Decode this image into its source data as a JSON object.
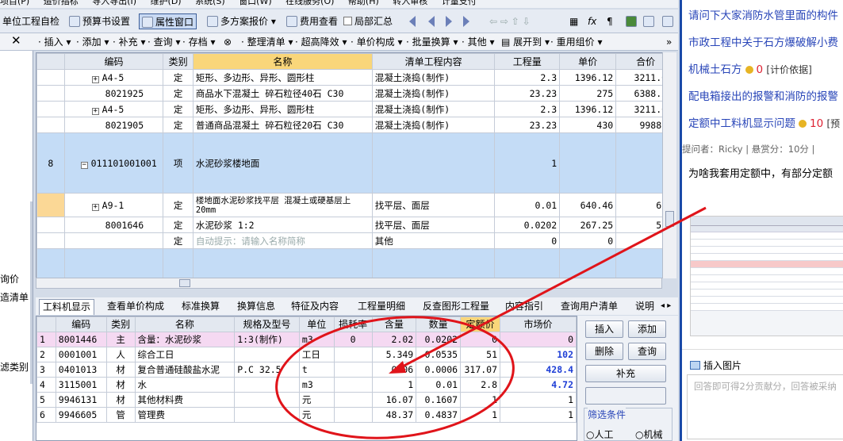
{
  "menubar": [
    "项目(P)",
    "造价指标",
    "导入导出(I)",
    "维护(D)",
    "系统(S)",
    "窗口(W)",
    "在线服务(O)",
    "帮助(H)",
    "转入审核",
    "计量支付"
  ],
  "toolbar1": {
    "self_check": "单位工程自检",
    "budget_settings": "预算书设置",
    "property_window": "属性窗口",
    "multi_plan_quote": "多方案报价",
    "fee_view": "费用查看",
    "partial_summary": "局部汇总"
  },
  "toolbar2": {
    "close": "✕",
    "items": [
      "插入",
      "添加",
      "补充",
      "查询",
      "存档",
      "整理清单",
      "超高降效",
      "单价构成",
      "批量换算",
      "其他",
      "展开到",
      "重用组价"
    ]
  },
  "leftpanel": [
    "询价",
    "造清单",
    "",
    "",
    "滤类别"
  ],
  "grid1": {
    "headers": [
      "编码",
      "类别",
      "名称",
      "清单工程内容",
      "工程量",
      "单价",
      "合价"
    ],
    "rows": [
      {
        "no": "",
        "code": "A4-5",
        "expand": "+",
        "type": "定",
        "name": "矩形、多边形、异形、圆形柱",
        "content": "混凝土浇捣(制作)",
        "qty": "2.3",
        "price": "1396.12",
        "total": "3211.08",
        "style": ""
      },
      {
        "no": "",
        "code": "8021925",
        "expand": "",
        "type": "定",
        "name": "商品水下混凝土 碎石粒径40石 C30",
        "content": "混凝土浇捣(制作)",
        "qty": "23.23",
        "price": "275",
        "total": "6388.25",
        "style": ""
      },
      {
        "no": "",
        "code": "A4-5",
        "expand": "+",
        "type": "定",
        "name": "矩形、多边形、异形、圆形柱",
        "content": "混凝土浇捣(制作)",
        "qty": "2.3",
        "price": "1396.12",
        "total": "3211.08",
        "style": ""
      },
      {
        "no": "",
        "code": "8021905",
        "expand": "",
        "type": "定",
        "name": "普通商品混凝土 碎石粒径20石 C30",
        "content": "混凝土浇捣(制作)",
        "qty": "23.23",
        "price": "430",
        "total": "9988.9",
        "style": ""
      },
      {
        "no": "8",
        "code": "011101001001",
        "expand": "−",
        "type": "项",
        "name": "水泥砂浆楼地面",
        "content": "",
        "qty": "1",
        "price": "",
        "total": "",
        "style": "blue-tall"
      },
      {
        "no": "",
        "code": "A9-1",
        "expand": "+",
        "type": "定",
        "name": "楼地面水泥砂浆找平层 混凝土或硬基层上 20mm",
        "content": "找平层、面层",
        "qty": "0.01",
        "price": "640.46",
        "total": "6.4",
        "style": "tall"
      },
      {
        "no": "",
        "code": "8001646",
        "expand": "",
        "type": "定",
        "name": "水泥砂浆 1:2",
        "content": "找平层、面层",
        "qty": "0.0202",
        "price": "267.25",
        "total": "5.4",
        "style": ""
      },
      {
        "no": "",
        "code": "",
        "expand": "",
        "type": "定",
        "name": "自动提示：请输入名称简称",
        "content": "其他",
        "qty": "0",
        "price": "0",
        "total": "0",
        "style": "hint"
      }
    ]
  },
  "tabs2": [
    "工料机显示",
    "查看单价构成",
    "标准换算",
    "换算信息",
    "特征及内容",
    "工程量明细",
    "反查图形工程量",
    "内容指引",
    "查询用户清单",
    "说明"
  ],
  "grid2": {
    "headers": [
      "编码",
      "类别",
      "名称",
      "规格及型号",
      "单位",
      "损耗率",
      "含量",
      "数量",
      "定额价",
      "市场价"
    ],
    "rows": [
      {
        "n": "1",
        "code": "8001446",
        "type": "主",
        "name": "含量：水泥砂浆",
        "spec": "1:3(制作)",
        "unit": "m3",
        "loss": "0",
        "amount": "2.02",
        "qty": "0.0202",
        "price": "0",
        "market": "0"
      },
      {
        "n": "2",
        "code": "0001001",
        "type": "人",
        "name": "综合工日",
        "spec": "",
        "unit": "工日",
        "loss": "",
        "amount": "5.349",
        "qty": "0.0535",
        "price": "51",
        "market": "102"
      },
      {
        "n": "3",
        "code": "0401013",
        "type": "材",
        "name": "复合普通硅酸盐水泥",
        "spec": "P.C 32.5",
        "unit": "t",
        "loss": "",
        "amount": "0.06",
        "qty": "0.0006",
        "price": "317.07",
        "market": "428.4"
      },
      {
        "n": "4",
        "code": "3115001",
        "type": "材",
        "name": "水",
        "spec": "",
        "unit": "m3",
        "loss": "",
        "amount": "1",
        "qty": "0.01",
        "price": "2.8",
        "market": "4.72"
      },
      {
        "n": "5",
        "code": "9946131",
        "type": "材",
        "name": "其他材料费",
        "spec": "",
        "unit": "元",
        "loss": "",
        "amount": "16.07",
        "qty": "0.1607",
        "price": "1",
        "market": "1"
      },
      {
        "n": "6",
        "code": "9946605",
        "type": "管",
        "name": "管理费",
        "spec": "",
        "unit": "元",
        "loss": "",
        "amount": "48.37",
        "qty": "0.4837",
        "price": "1",
        "market": "1"
      }
    ]
  },
  "rightbtns": {
    "insert": "插入",
    "add": "添加",
    "delete": "删除",
    "query": "查询",
    "supplement": "补充",
    "filter_title": "筛选条件",
    "labor": "人工",
    "machine": "机械"
  },
  "sidebar": {
    "q1": "请问下大家消防水管里面的构件",
    "q2": "市政工程中关于石方爆破解小费",
    "q3": "机械土石方",
    "q3_points": "0",
    "q3_tag": "[计价依据]",
    "q4": "配电箱接出的报警和消防的报警",
    "q5": "定额中工料机显示问题",
    "q5_points": "10",
    "q5_tag": "[预",
    "meta": "提问者：Ricky  |  悬赏分：10分  |",
    "body": "为啥我套用定额中，有部分定额",
    "insert_image": "插入图片",
    "editor_placeholder": "回答即可得2分贡献分，回答被采纳"
  },
  "colors": {
    "annotation": "#e0141a",
    "selected_header": "#f9d67a",
    "group_row": "#c4dcf6",
    "pink_row": "#f5d9f2",
    "sidebar_link": "#2845b8"
  }
}
